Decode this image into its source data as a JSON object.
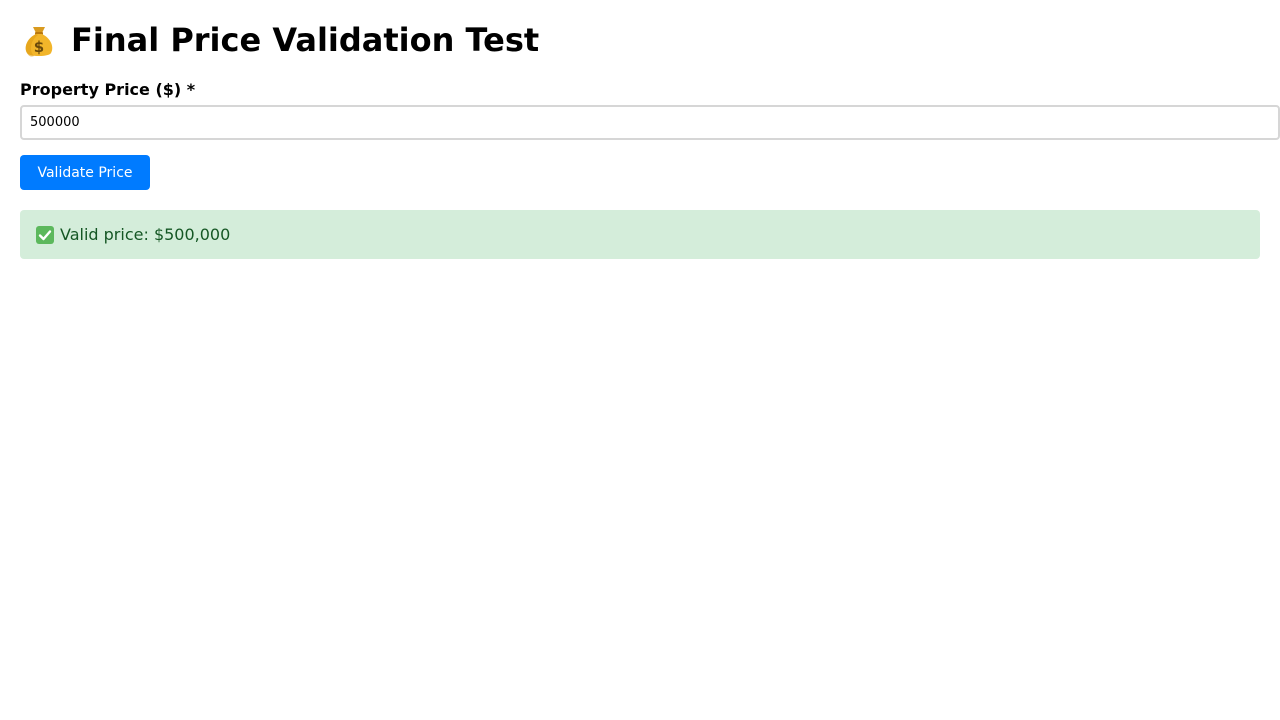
{
  "header": {
    "title": "Final Price Validation Test",
    "icon": "money-bag-icon"
  },
  "form": {
    "price_label": "Property Price ($) *",
    "price_value": "500000",
    "validate_button_label": "Validate Price"
  },
  "result": {
    "icon": "check-mark-icon",
    "message": "Valid price: $500,000",
    "status": "success"
  },
  "colors": {
    "button_bg": "#007bff",
    "success_bg": "#d4edda",
    "success_text": "#155724"
  }
}
